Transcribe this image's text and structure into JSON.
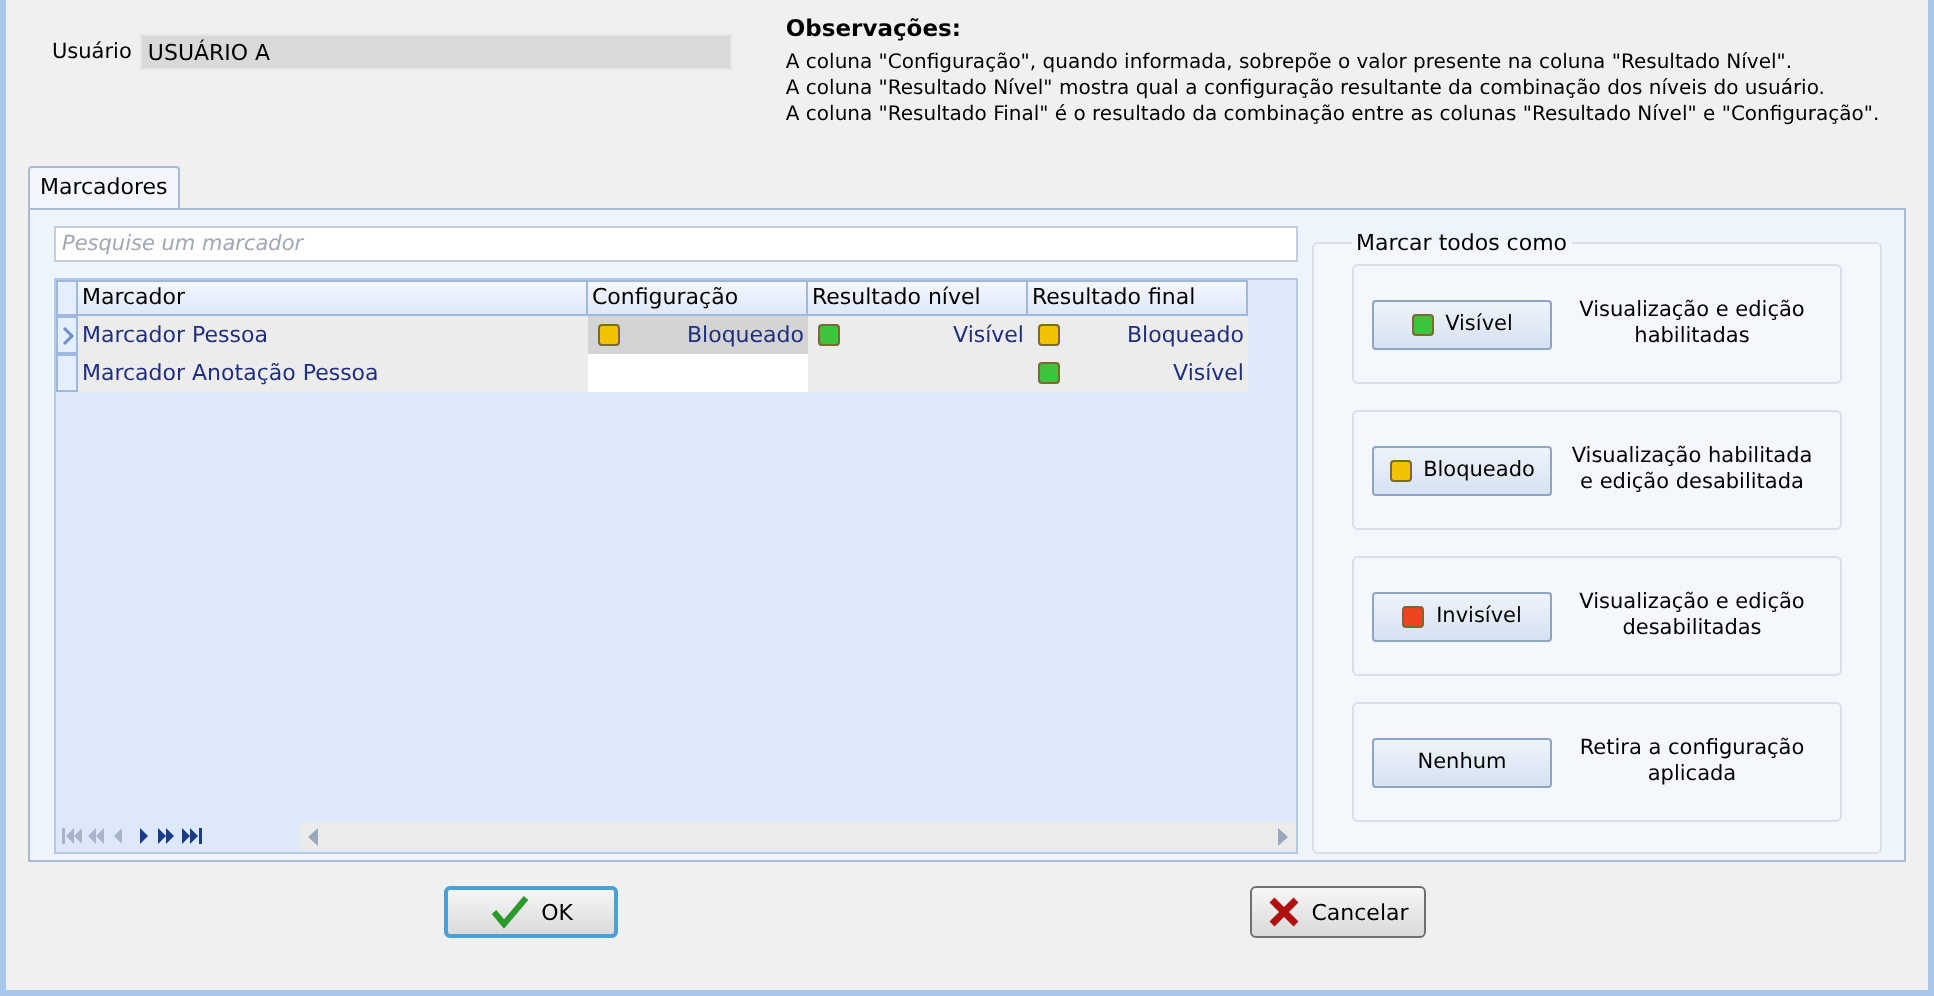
{
  "user": {
    "label": "Usuário",
    "value": "USUÁRIO A"
  },
  "notes": {
    "title": "Observações:",
    "lines": [
      "A coluna \"Configuração\", quando informada, sobrepõe o valor presente na coluna \"Resultado Nível\".",
      "A coluna \"Resultado Nível\" mostra qual a configuração resultante da combinação dos níveis do usuário.",
      "A coluna \"Resultado Final\" é o resultado da combinação entre as colunas \"Resultado Nível\" e \"Configuração\"."
    ]
  },
  "tabs": [
    {
      "label": "Marcadores",
      "selected": true
    }
  ],
  "search": {
    "placeholder": "Pesquise um marcador"
  },
  "table": {
    "columns": [
      "Marcador",
      "Configuração",
      "Resultado nível",
      "Resultado final"
    ],
    "rows": [
      {
        "selected": true,
        "marcador": "Marcador Pessoa",
        "configuracao": {
          "text": "Bloqueado",
          "color": "#f2c200"
        },
        "resultado_nivel": {
          "text": "Visível",
          "color": "#3cc43c"
        },
        "resultado_final": {
          "text": "Bloqueado",
          "color": "#f2c200"
        }
      },
      {
        "selected": false,
        "marcador": "Marcador Anotação Pessoa",
        "resultado_final": {
          "text": "Visível",
          "color": "#3cc43c"
        }
      }
    ]
  },
  "mark_all": {
    "title": "Marcar todos como",
    "options": [
      {
        "label": "Visível",
        "color": "#3cc43c",
        "description": "Visualização e edição habilitadas"
      },
      {
        "label": "Bloqueado",
        "color": "#f2c200",
        "description": "Visualização habilitada e edição desabilitada"
      },
      {
        "label": "Invisível",
        "color": "#ee4422",
        "description": "Visualização e edição desabilitadas"
      },
      {
        "label": "Nenhum",
        "description": "Retira a configuração aplicada"
      }
    ]
  },
  "buttons": [
    {
      "kind": "ok",
      "label": "OK"
    },
    {
      "kind": "cancel",
      "label": "Cancelar"
    }
  ]
}
